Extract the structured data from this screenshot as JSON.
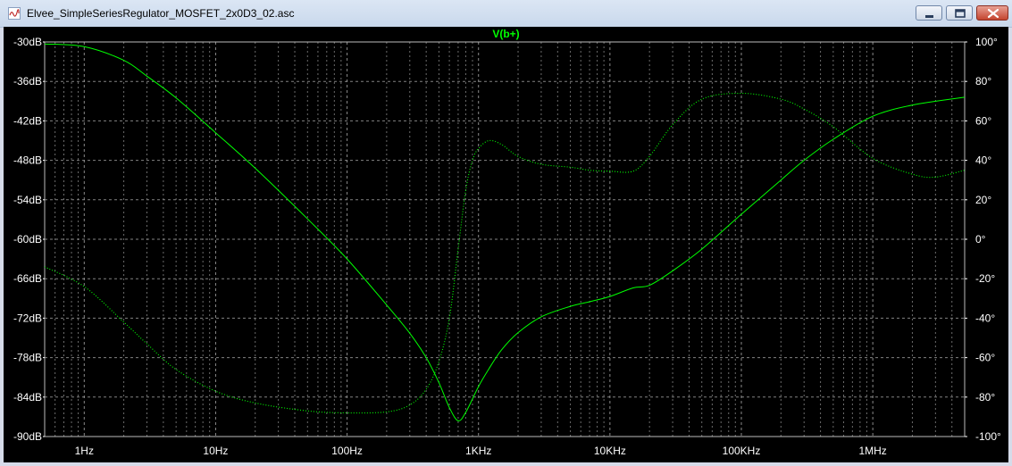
{
  "window": {
    "title": "Elvee_SimpleSeriesRegulator_MOSFET_2x0D3_02.asc",
    "controls": [
      "minimize-icon",
      "maximize-icon",
      "close-icon"
    ]
  },
  "colors": {
    "plot_background": "#000000",
    "trace": "#00ff00",
    "grid": "#9a9a9a",
    "axis_text": "#ffffff",
    "title_text": "#00ff00"
  },
  "chart_data": {
    "type": "line",
    "title": "V(b+)",
    "x_scale": "log",
    "xlim": [
      0.5,
      5000000
    ],
    "x_tick_values": [
      1,
      10,
      100,
      1000,
      10000,
      100000,
      1000000
    ],
    "x_tick_labels": [
      "1Hz",
      "10Hz",
      "100Hz",
      "1KHz",
      "10KHz",
      "100KHz",
      "1MHz"
    ],
    "ylim": [
      -90,
      -30
    ],
    "y_tick_values": [
      -30,
      -36,
      -42,
      -48,
      -54,
      -60,
      -66,
      -72,
      -78,
      -84,
      -90
    ],
    "y_tick_labels": [
      "-30dB",
      "-36dB",
      "-42dB",
      "-48dB",
      "-54dB",
      "-60dB",
      "-66dB",
      "-72dB",
      "-78dB",
      "-84dB",
      "-90dB"
    ],
    "y2lim": [
      -100,
      100
    ],
    "y2_tick_values": [
      100,
      80,
      60,
      40,
      20,
      0,
      -20,
      -40,
      -60,
      -80,
      -100
    ],
    "y2_tick_labels": [
      "100°",
      "80°",
      "60°",
      "40°",
      "20°",
      "0°",
      "-20°",
      "-40°",
      "-60°",
      "-80°",
      "-100°"
    ],
    "grid": true,
    "series": [
      {
        "name": "",
        "axis": "left",
        "style": "solid",
        "x": [
          0.5,
          1,
          2,
          3,
          5,
          10,
          20,
          50,
          100,
          200,
          300,
          400,
          500,
          600,
          700,
          800,
          1000,
          1200,
          1500,
          2000,
          3000,
          5000,
          7000,
          10000,
          15000,
          20000,
          30000,
          50000,
          100000,
          200000,
          300000,
          500000,
          1000000,
          2000000,
          5000000
        ],
        "y": [
          -30.3,
          -30.7,
          -32.8,
          -35.2,
          -38.5,
          -43.8,
          -49.2,
          -56.9,
          -63.0,
          -70.0,
          -74.3,
          -78.0,
          -81.8,
          -85.6,
          -87.6,
          -86.3,
          -82.4,
          -79.7,
          -76.8,
          -74.2,
          -71.8,
          -70.2,
          -69.5,
          -68.7,
          -67.4,
          -67.0,
          -64.8,
          -61.5,
          -56.2,
          -51.0,
          -48.0,
          -44.8,
          -41.3,
          -39.6,
          -38.4
        ]
      },
      {
        "name": "",
        "axis": "right",
        "style": "dotted",
        "x": [
          0.5,
          1,
          2,
          3,
          5,
          10,
          20,
          50,
          100,
          200,
          300,
          400,
          500,
          600,
          700,
          800,
          900,
          1000,
          1200,
          1500,
          2000,
          3000,
          5000,
          7000,
          10000,
          15000,
          20000,
          30000,
          50000,
          100000,
          200000,
          300000,
          500000,
          1000000,
          2000000,
          3000000,
          5000000
        ],
        "y": [
          -14,
          -24,
          -42,
          -53,
          -66,
          -77,
          -83,
          -87,
          -88,
          -87.5,
          -84,
          -76,
          -62,
          -40,
          -5,
          25,
          40,
          46,
          50,
          48,
          42,
          38,
          36.5,
          35,
          34.5,
          34.5,
          42,
          58,
          71,
          74,
          71,
          66,
          57,
          41,
          33,
          31.5,
          35
        ]
      }
    ]
  }
}
